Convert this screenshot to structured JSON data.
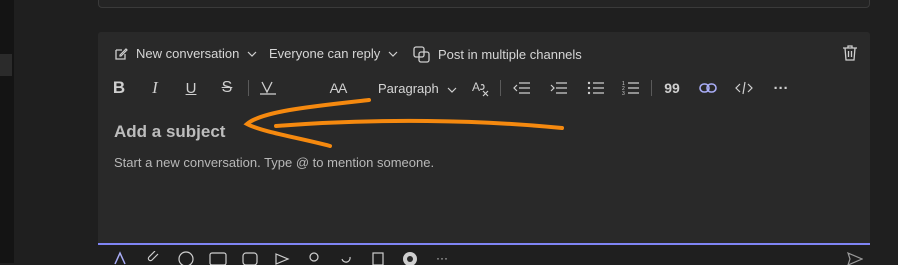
{
  "header": {
    "new_conversation_label": "New conversation",
    "reply_option_label": "Everyone can reply",
    "multi_channel_label": "Post in multiple channels"
  },
  "toolbar": {
    "bold": "B",
    "italic": "I",
    "underline": "U",
    "strike": "S",
    "font_size": "AA",
    "paragraph_label": "Paragraph",
    "quote": "99",
    "more": "···"
  },
  "composer": {
    "subject_placeholder": "Add a subject",
    "body_placeholder": "Start a new conversation. Type @ to mention someone."
  },
  "colors": {
    "accent": "#7f85f5",
    "annotation": "#f5890f",
    "background": "#1f1f1f",
    "composer": "#292929"
  },
  "icons": {
    "compose": "edit-icon",
    "multi_channel": "copy-channels-icon",
    "delete": "trash-icon",
    "highlight": "highlighter-icon",
    "paragraph_dropdown": "chevron-down-icon",
    "clear_format": "clear-format-icon",
    "outdent": "outdent-icon",
    "indent": "indent-icon",
    "bullets": "bullet-list-icon",
    "numbers": "numbered-list-icon",
    "link": "link-icon",
    "code": "code-icon"
  }
}
